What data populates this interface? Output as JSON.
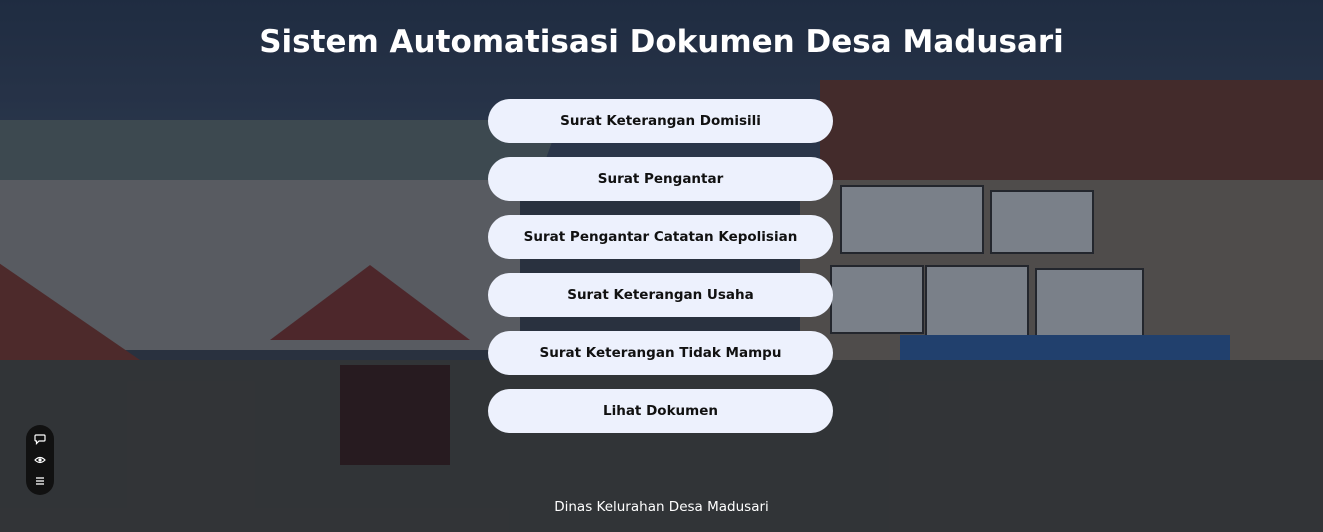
{
  "page": {
    "title": "Sistem Automatisasi Dokumen Desa Madusari",
    "footer": "Dinas Kelurahan Desa Madusari"
  },
  "menu": {
    "buttons": [
      "Surat Keterangan Domisili",
      "Surat Pengantar",
      "Surat Pengantar Catatan Kepolisian",
      "Surat Keterangan Usaha",
      "Surat Keterangan Tidak Mampu",
      "Lihat Dokumen"
    ]
  },
  "toolbar": {
    "icons": [
      "comment-icon",
      "eye-icon",
      "list-icon"
    ]
  },
  "colors": {
    "button_bg": "#edf1fd",
    "button_text": "#111111",
    "title_text": "#ffffff",
    "toolbar_bg": "#111111"
  }
}
